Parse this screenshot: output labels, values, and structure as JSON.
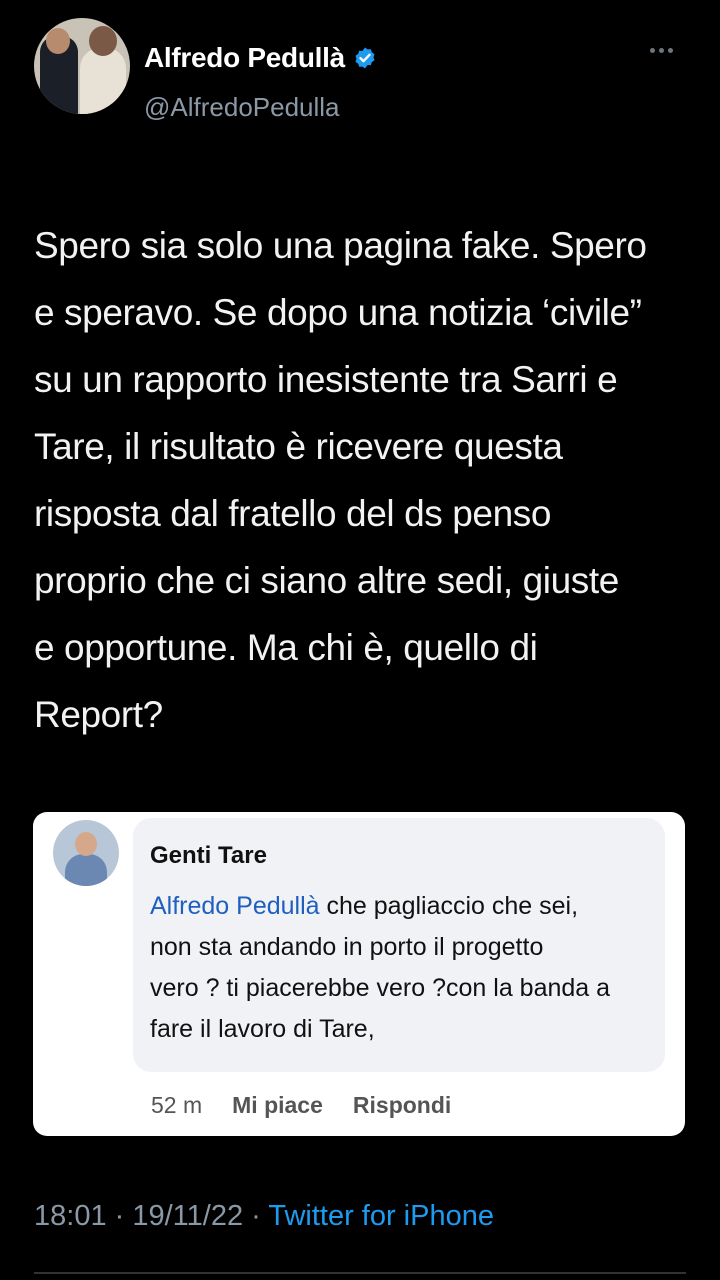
{
  "author": {
    "display_name": "Alfredo Pedullà",
    "handle": "@AlfredoPedulla"
  },
  "tweet": {
    "lines": [
      "Spero sia solo una pagina fake. Spero",
      "e speravo. Se dopo una notizia ‘civile”",
      "su un rapporto inesistente tra Sarri e",
      "Tare, il risultato è ricevere questa",
      "risposta dal fratello del ds penso",
      "proprio che ci siano altre sedi, giuste",
      "e opportune. Ma chi è, quello di",
      "Report?"
    ]
  },
  "embedded_comment": {
    "commenter": "Genti Tare",
    "mention": "Alfredo Pedullà",
    "lines": [
      " che pagliaccio che sei,",
      "non sta andando in porto il progetto",
      "vero ? ti piacerebbe vero ?con la banda a",
      "fare il lavoro di Tare,"
    ],
    "time": "52 m",
    "like_label": "Mi piace",
    "reply_label": "Rispondi"
  },
  "meta": {
    "timestamp": "18:01 · 19/11/22 · ",
    "source": "Twitter for iPhone"
  },
  "colors": {
    "background": "#000000",
    "link": "#1d9bf0",
    "verified": "#1d9bf0"
  },
  "icons": [
    "verified-badge-icon",
    "more-options-icon"
  ]
}
